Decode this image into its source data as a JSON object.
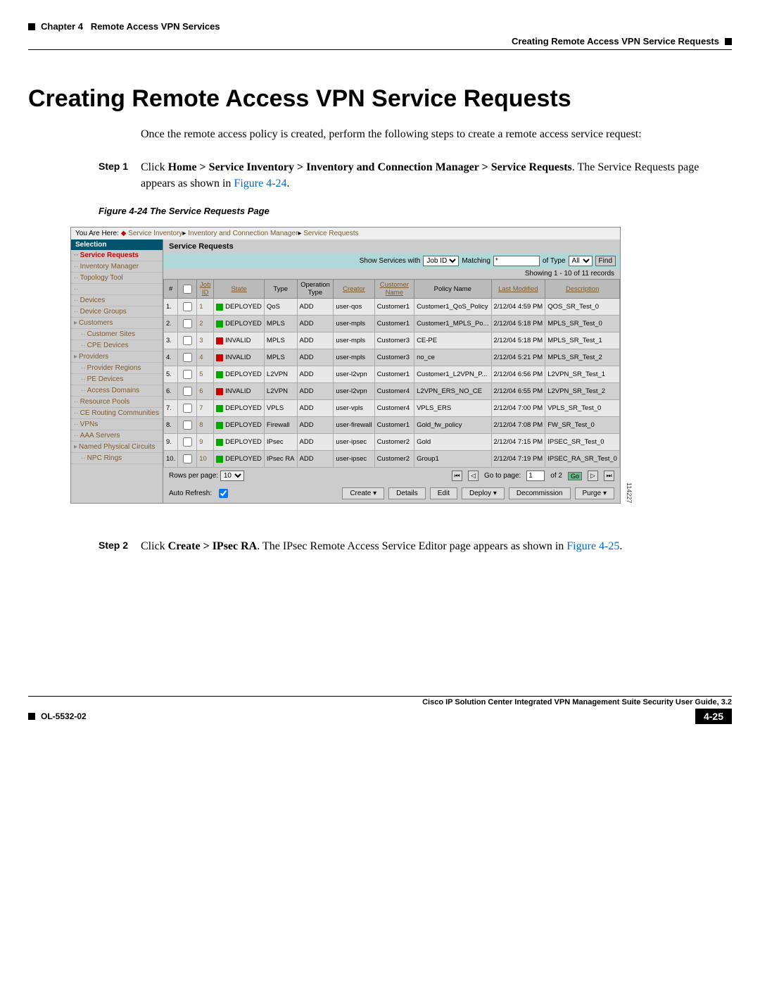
{
  "header": {
    "chapter": "Chapter 4",
    "chapterTitle": "Remote Access VPN Services",
    "subtitle": "Creating Remote Access VPN Service Requests"
  },
  "h1": "Creating Remote Access VPN Service Requests",
  "intro": "Once the remote access policy is created, perform the following steps to create a remote access service request:",
  "step1": {
    "label": "Step 1",
    "pre": "Click ",
    "bold": "Home > Service Inventory > Inventory and Connection Manager > Service Requests",
    "mid": ". The Service Requests page appears as shown in ",
    "figref": "Figure 4-24",
    "post": "."
  },
  "figcap": "Figure 4-24   The Service Requests Page",
  "crumb": {
    "pre": "You Are Here: ",
    "c1": "Service Inventory",
    "c2": "Inventory and Connection Manager",
    "c3": "Service Requests"
  },
  "sidebar": {
    "header": "Selection",
    "items": [
      {
        "t": "Service Requests",
        "cur": true
      },
      {
        "t": "Inventory Manager"
      },
      {
        "t": "Topology Tool"
      },
      {
        "t": ""
      },
      {
        "t": "Devices"
      },
      {
        "t": "Device Groups"
      },
      {
        "t": "Customers",
        "exp": true
      },
      {
        "t": "Customer Sites",
        "sub": true
      },
      {
        "t": "CPE Devices",
        "sub": true
      },
      {
        "t": "Providers",
        "exp": true
      },
      {
        "t": "Provider Regions",
        "sub": true
      },
      {
        "t": "PE Devices",
        "sub": true
      },
      {
        "t": "Access Domains",
        "sub": true
      },
      {
        "t": "Resource Pools"
      },
      {
        "t": "CE Routing Communities"
      },
      {
        "t": "VPNs"
      },
      {
        "t": "AAA Servers"
      },
      {
        "t": "Named Physical Circuits",
        "exp": true
      },
      {
        "t": "NPC Rings",
        "sub": true
      }
    ]
  },
  "main": {
    "title": "Service Requests",
    "filter": {
      "l1": "Show Services with",
      "sel1": "Job ID",
      "l2": "Matching",
      "v2": "*",
      "l3": "of Type",
      "sel3": "All",
      "btn": "Find"
    },
    "showing": "Showing 1 - 10 of 11 records",
    "cols": {
      "num": "#",
      "chk": "",
      "job": "Job ID",
      "state": "State",
      "type": "Type",
      "op": "Operation Type",
      "creator": "Creator",
      "cust": "Customer Name",
      "policy": "Policy Name",
      "mod": "Last Modified",
      "desc": "Description"
    },
    "rows": [
      {
        "n": "1.",
        "id": "1",
        "state": "DEPLOYED",
        "sc": "g",
        "type": "QoS",
        "op": "ADD",
        "cr": "user-qos",
        "cu": "Customer1",
        "po": "Customer1_QoS_Policy",
        "mo": "2/12/04 4:59 PM",
        "de": "QOS_SR_Test_0"
      },
      {
        "n": "2.",
        "id": "2",
        "state": "DEPLOYED",
        "sc": "g",
        "type": "MPLS",
        "op": "ADD",
        "cr": "user-mpls",
        "cu": "Customer1",
        "po": "Customer1_MPLS_Po...",
        "mo": "2/12/04 5:18 PM",
        "de": "MPLS_SR_Test_0"
      },
      {
        "n": "3.",
        "id": "3",
        "state": "INVALID",
        "sc": "r",
        "type": "MPLS",
        "op": "ADD",
        "cr": "user-mpls",
        "cu": "Customer3",
        "po": "CE-PE",
        "mo": "2/12/04 5:18 PM",
        "de": "MPLS_SR_Test_1"
      },
      {
        "n": "4.",
        "id": "4",
        "state": "INVALID",
        "sc": "r",
        "type": "MPLS",
        "op": "ADD",
        "cr": "user-mpls",
        "cu": "Customer3",
        "po": "no_ce",
        "mo": "2/12/04 5:21 PM",
        "de": "MPLS_SR_Test_2"
      },
      {
        "n": "5.",
        "id": "5",
        "state": "DEPLOYED",
        "sc": "g",
        "type": "L2VPN",
        "op": "ADD",
        "cr": "user-l2vpn",
        "cu": "Customer1",
        "po": "Customer1_L2VPN_P...",
        "mo": "2/12/04 6:56 PM",
        "de": "L2VPN_SR_Test_1"
      },
      {
        "n": "6.",
        "id": "6",
        "state": "INVALID",
        "sc": "r",
        "type": "L2VPN",
        "op": "ADD",
        "cr": "user-l2vpn",
        "cu": "Customer4",
        "po": "L2VPN_ERS_NO_CE",
        "mo": "2/12/04 6:55 PM",
        "de": "L2VPN_SR_Test_2"
      },
      {
        "n": "7.",
        "id": "7",
        "state": "DEPLOYED",
        "sc": "g",
        "type": "VPLS",
        "op": "ADD",
        "cr": "user-vpls",
        "cu": "Customer4",
        "po": "VPLS_ERS",
        "mo": "2/12/04 7:00 PM",
        "de": "VPLS_SR_Test_0"
      },
      {
        "n": "8.",
        "id": "8",
        "state": "DEPLOYED",
        "sc": "g",
        "type": "Firewall",
        "op": "ADD",
        "cr": "user-firewall",
        "cu": "Customer1",
        "po": "Gold_fw_policy",
        "mo": "2/12/04 7:08 PM",
        "de": "FW_SR_Test_0"
      },
      {
        "n": "9.",
        "id": "9",
        "state": "DEPLOYED",
        "sc": "g",
        "type": "IPsec",
        "op": "ADD",
        "cr": "user-ipsec",
        "cu": "Customer2",
        "po": "Gold",
        "mo": "2/12/04 7:15 PM",
        "de": "IPSEC_SR_Test_0"
      },
      {
        "n": "10.",
        "id": "10",
        "state": "DEPLOYED",
        "sc": "g",
        "type": "IPsec RA",
        "op": "ADD",
        "cr": "user-ipsec",
        "cu": "Customer2",
        "po": "Group1",
        "mo": "2/12/04 7:19 PM",
        "de": "IPSEC_RA_SR_Test_0"
      }
    ],
    "pager": {
      "rpp": "Rows per page:",
      "rppv": "10",
      "goto": "Go to page:",
      "pg": "1",
      "of": "of 2",
      "go": "Go"
    },
    "actions": {
      "auto": "Auto Refresh:",
      "create": "Create",
      "details": "Details",
      "edit": "Edit",
      "deploy": "Deploy",
      "decom": "Decommission",
      "purge": "Purge"
    }
  },
  "figid": "114227",
  "step2": {
    "label": "Step 2",
    "pre": "Click ",
    "bold": "Create > IPsec RA",
    "mid": ". The IPsec Remote Access Service Editor page appears as shown in ",
    "figref": "Figure 4-25",
    "post": "."
  },
  "footer": {
    "book": "Cisco IP Solution Center Integrated VPN Management Suite Security User Guide, 3.2",
    "doc": "OL-5532-02",
    "page": "4-25"
  }
}
